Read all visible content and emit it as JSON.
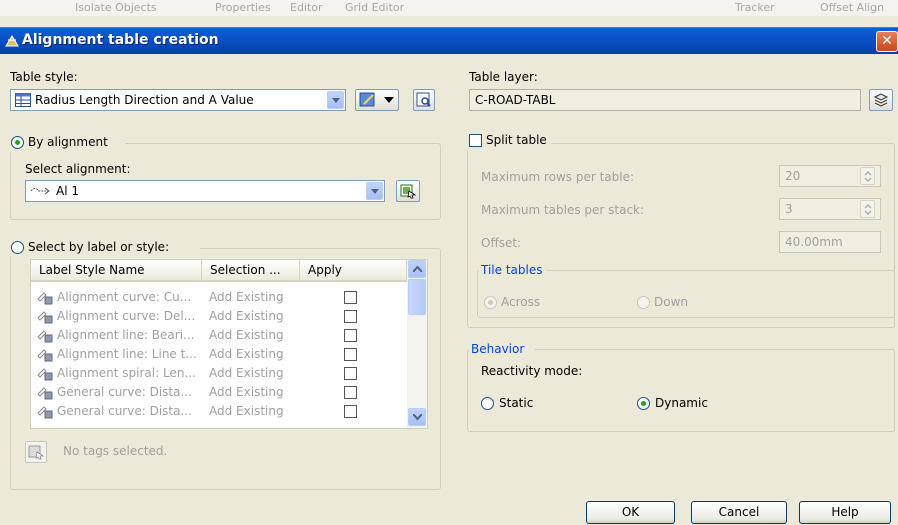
{
  "background_toolbar": {
    "left_item": "Isolate Objects",
    "items": [
      "Properties",
      "Editor",
      "Grid Editor"
    ],
    "right_items": [
      "Tracker",
      "Offset Align"
    ]
  },
  "dialog": {
    "title": "Alignment table creation",
    "table_style_label": "Table style:",
    "table_style_value": "Radius Length Direction and A Value",
    "table_layer_label": "Table layer:",
    "table_layer_value": "C-ROAD-TABL",
    "by_alignment_label": "By alignment",
    "select_alignment_label": "Select alignment:",
    "select_alignment_value": "Al 1",
    "select_by_label_label": "Select by label or style:",
    "list": {
      "columns": [
        "Label Style Name",
        "Selection ...",
        "Apply"
      ],
      "rows": [
        {
          "name": "Alignment curve: Cu...",
          "selection": "Add Existing"
        },
        {
          "name": "Alignment curve: Del...",
          "selection": "Add Existing"
        },
        {
          "name": "Alignment line: Beari...",
          "selection": "Add Existing"
        },
        {
          "name": "Alignment line: Line t...",
          "selection": "Add Existing"
        },
        {
          "name": "Alignment spiral: Len...",
          "selection": "Add Existing"
        },
        {
          "name": "General curve: Dista...",
          "selection": "Add Existing"
        },
        {
          "name": "General curve: Dista...",
          "selection": "Add Existing"
        }
      ]
    },
    "no_tags_label": "No tags selected.",
    "split_table_label": "Split table",
    "max_rows_label": "Maximum rows per table:",
    "max_rows_value": "20",
    "max_tables_label": "Maximum tables per stack:",
    "max_tables_value": "3",
    "offset_label": "Offset:",
    "offset_value": "40.00mm",
    "tile_tables_label": "Tile tables",
    "across_label": "Across",
    "down_label": "Down",
    "behavior_label": "Behavior",
    "reactivity_label": "Reactivity mode:",
    "static_label": "Static",
    "dynamic_label": "Dynamic",
    "ok_label": "OK",
    "cancel_label": "Cancel",
    "help_label": "Help"
  },
  "colors": {
    "titlebar": "#0a52c8",
    "dialog_bg": "#ece9d8",
    "group_title": "#0046d5",
    "disabled_text": "#a0a0a0"
  }
}
